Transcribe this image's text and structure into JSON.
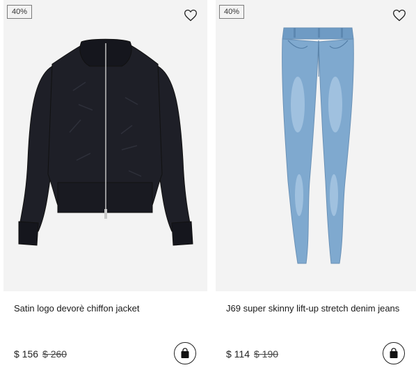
{
  "products": [
    {
      "badge": "40%",
      "name": "Satin logo devorè chiffon jacket",
      "price": "$ 156",
      "old_price": "$ 260",
      "image_icon": "black-bomber-jacket",
      "wishlist_icon": "heart-outline-icon",
      "cart_icon": "shopping-bag-icon"
    },
    {
      "badge": "40%",
      "name": "J69 super skinny lift-up stretch denim jeans",
      "price": "$ 114",
      "old_price": "$ 190",
      "image_icon": "light-blue-skinny-jeans",
      "wishlist_icon": "heart-outline-icon",
      "cart_icon": "shopping-bag-icon"
    }
  ],
  "colors": {
    "image_bg": "#f3f3f3",
    "jacket": "#1d1e26",
    "denim": "#7fa9cf"
  }
}
